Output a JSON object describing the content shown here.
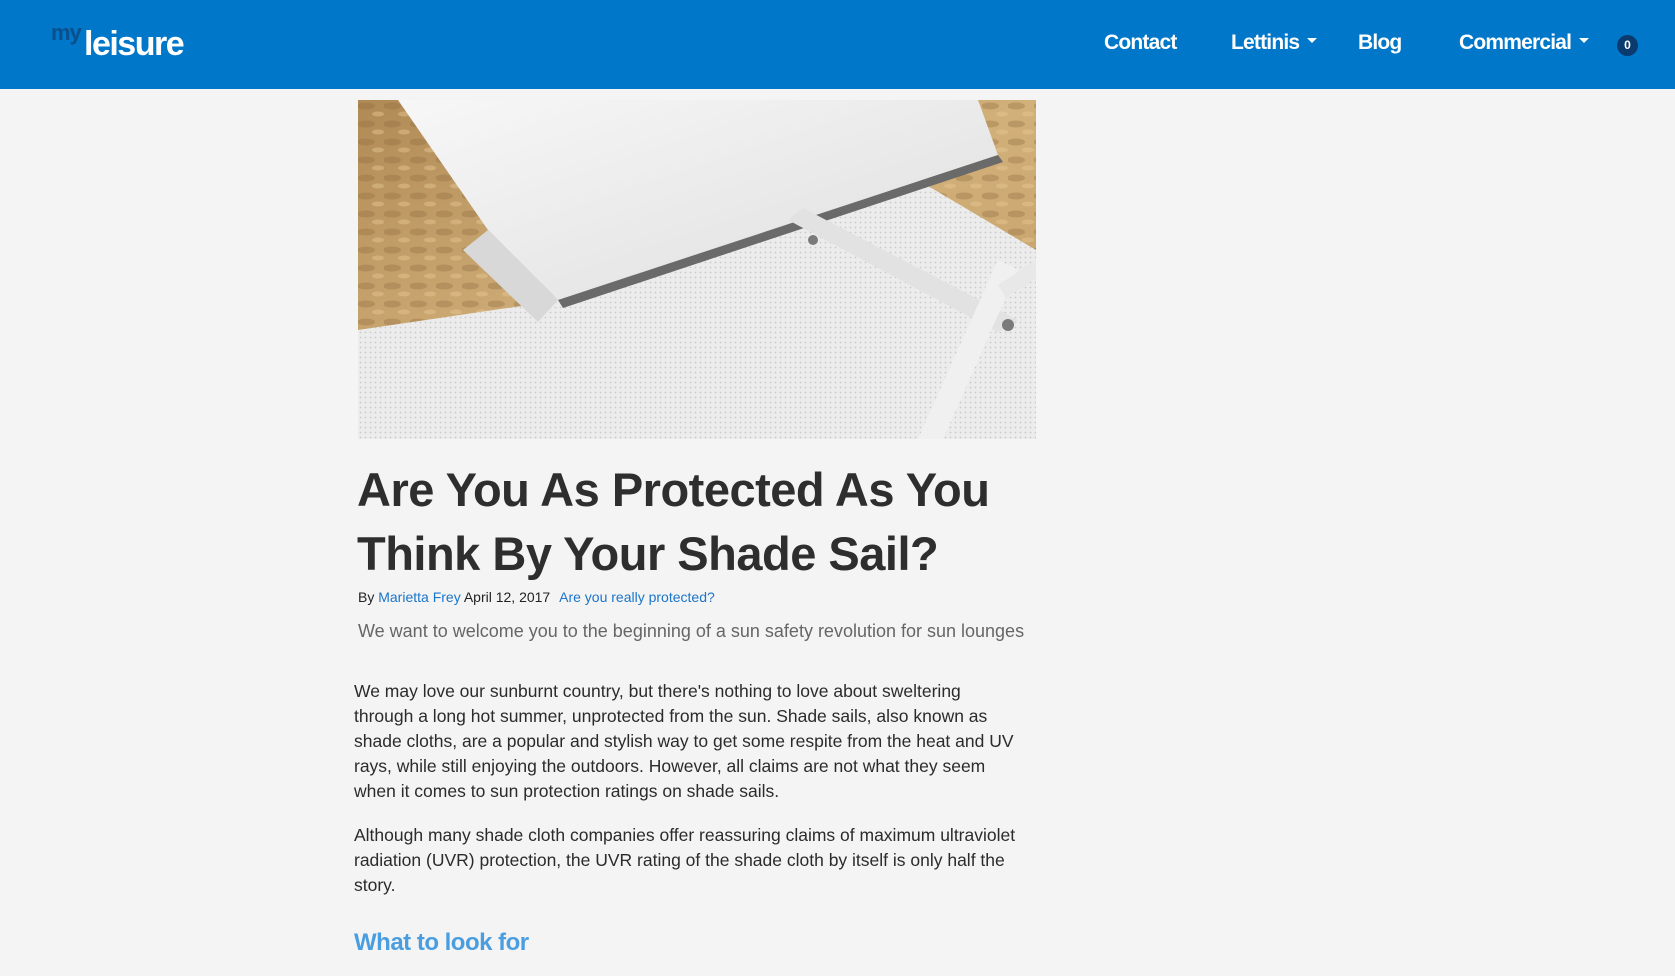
{
  "colors": {
    "navbar": "#0077c8",
    "link": "#1b75c9",
    "section_heading": "#4a9ee0",
    "page_background": "#f4f4f4"
  },
  "header": {
    "logo_small": "my",
    "logo_main": "leisure",
    "nav": {
      "contact": "Contact",
      "lettinis": "Lettinis",
      "blog": "Blog",
      "commercial": "Commercial"
    },
    "cart_count": "0"
  },
  "article": {
    "hero_image_icon": "beach-lounger-photo",
    "title": "Are You As Protected As You Think By Your Shade Sail?",
    "by_label": "By",
    "author": "Marietta Frey",
    "date": "April 12, 2017",
    "tag": "Are you really protected?",
    "subtitle": "We want to welcome you to the beginning of a sun safety revolution for sun lounges",
    "paragraphs": [
      "We may love our sunburnt country, but there's nothing to love about sweltering through a long hot summer, unprotected from the sun. Shade sails, also known as shade cloths, are a popular and stylish way to get some respite from the heat and UV rays, while still enjoying the outdoors. However, all claims are not what they seem when it comes to sun protection ratings on shade sails.",
      "Although many shade cloth companies offer reassuring claims of maximum ultraviolet radiation (UVR) protection, the UVR rating of the shade cloth by itself is only half the story."
    ],
    "section_heading": "What to look for"
  }
}
